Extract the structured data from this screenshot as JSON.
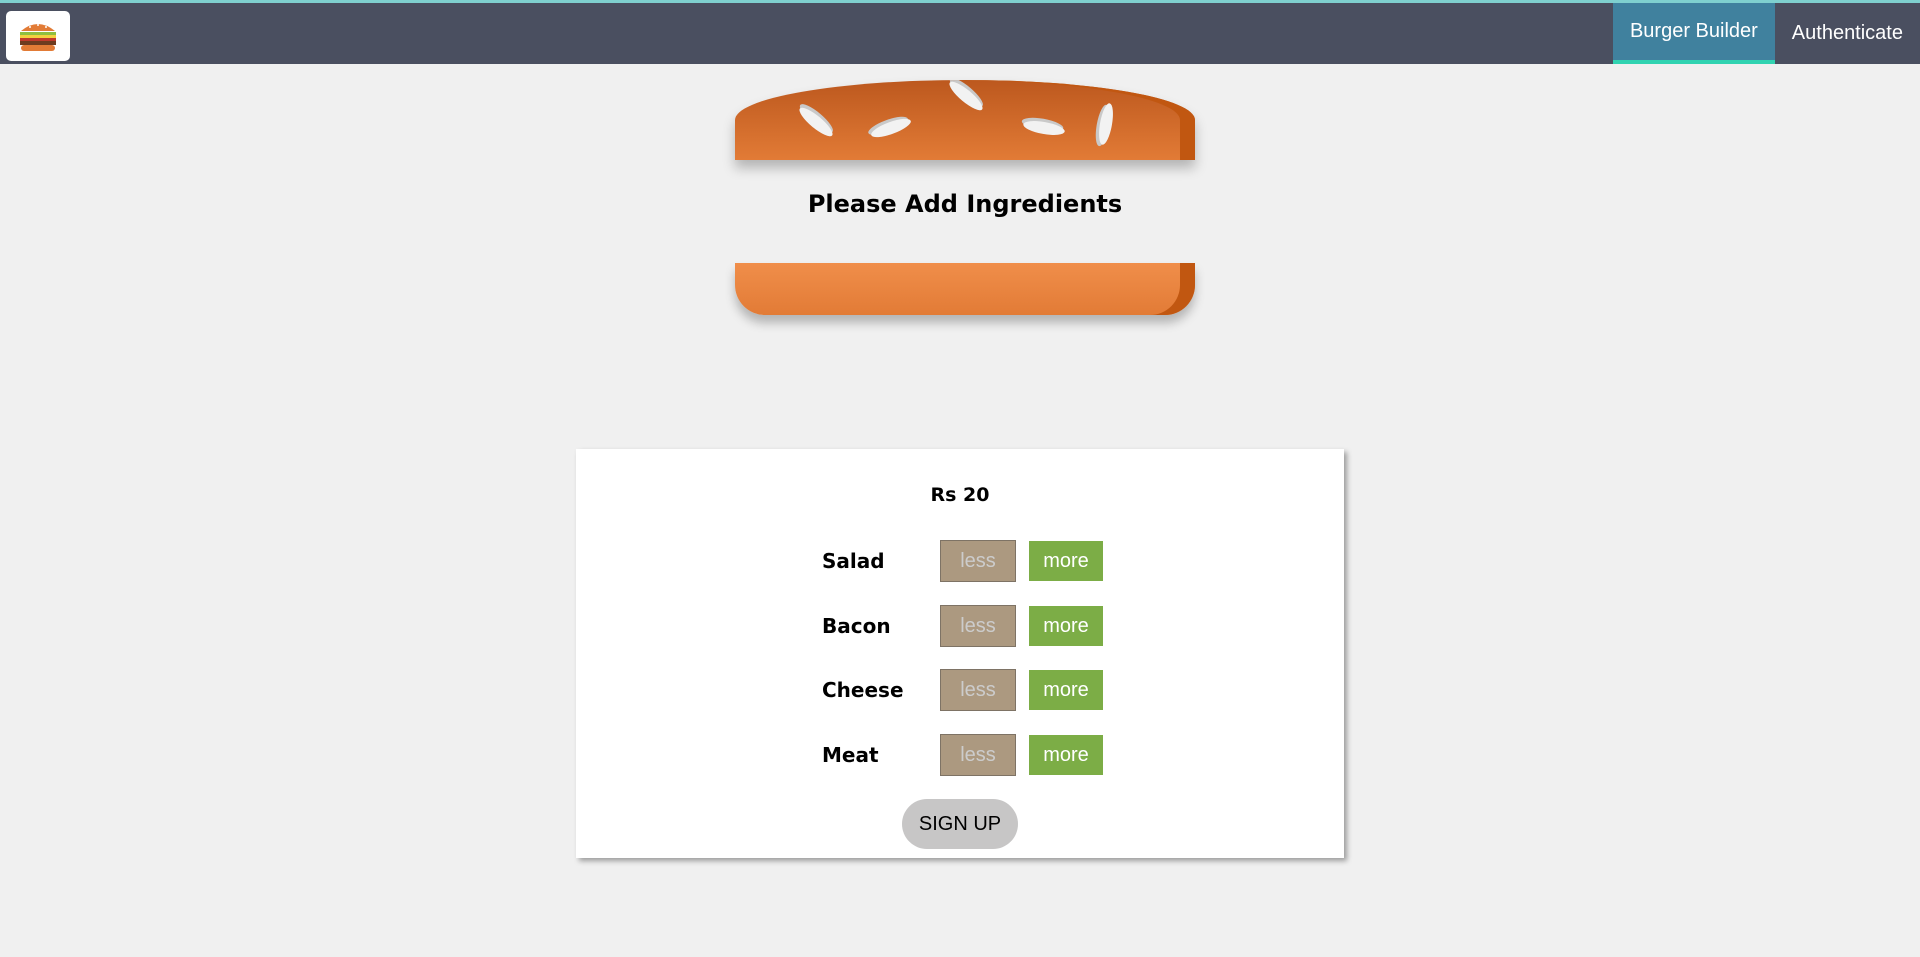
{
  "header": {
    "logo_icon": "burger-logo-icon",
    "nav": [
      {
        "label": "Burger Builder",
        "active": true
      },
      {
        "label": "Authenticate",
        "active": false
      }
    ]
  },
  "burger": {
    "message": "Please Add Ingredients"
  },
  "controls": {
    "price": "Rs 20",
    "ingredients": [
      {
        "label": "Salad",
        "less": "less",
        "more": "more"
      },
      {
        "label": "Bacon",
        "less": "less",
        "more": "more"
      },
      {
        "label": "Cheese",
        "less": "less",
        "more": "more"
      },
      {
        "label": "Meat",
        "less": "less",
        "more": "more"
      }
    ],
    "order_button": "SIGN UP"
  },
  "colors": {
    "toolbar": "#4a4f60",
    "nav_active": "#40819e",
    "nav_active_border": "#31d3b1",
    "more_button": "#7cad46",
    "less_button": "#ac9980",
    "bread": "#e27b36"
  }
}
